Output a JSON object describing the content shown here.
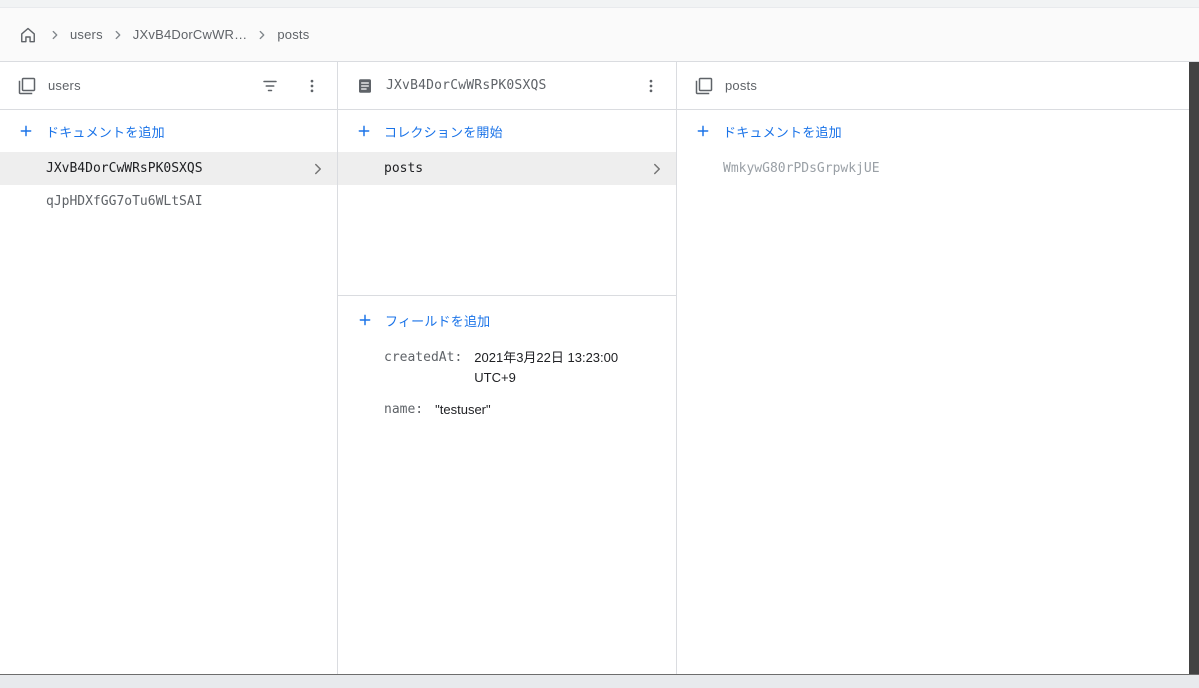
{
  "breadcrumb": {
    "items": [
      "users",
      "JXvB4DorCwWR…",
      "posts"
    ]
  },
  "panels": {
    "users": {
      "title": "users",
      "add_document_label": "ドキュメントを追加",
      "documents": [
        {
          "id": "JXvB4DorCwWRsPK0SXQS",
          "selected": true
        },
        {
          "id": "qJpHDXfGG7oTu6WLtSAI",
          "selected": false
        }
      ]
    },
    "document": {
      "title": "JXvB4DorCwWRsPK0SXQS",
      "start_collection_label": "コレクションを開始",
      "collections": [
        {
          "id": "posts",
          "selected": true
        }
      ],
      "add_field_label": "フィールドを追加",
      "fields": [
        {
          "label": "createdAt:",
          "value": "2021年3月22日 13:23:00 UTC+9"
        },
        {
          "label": "name:",
          "value": "\"testuser\""
        }
      ]
    },
    "posts": {
      "title": "posts",
      "add_document_label": "ドキュメントを追加",
      "documents": [
        {
          "id": "WmkywG80rPDsGrpwkjUE",
          "selected": false
        }
      ]
    }
  },
  "icons": {
    "home": "home-icon",
    "breadcrumb_separator": "chevron-right-icon",
    "collection": "collection-icon",
    "document": "document-icon",
    "filter": "filter-list-icon",
    "menu": "kebab-menu-icon",
    "add": "plus-icon",
    "row_chevron": "chevron-right-icon"
  },
  "colors": {
    "accent": "#1a73e8",
    "selected_row_bg": "#eeeeee",
    "text_gray": "#5f6368",
    "muted_id_gray": "#9aa0a6",
    "border": "#dadce0"
  }
}
